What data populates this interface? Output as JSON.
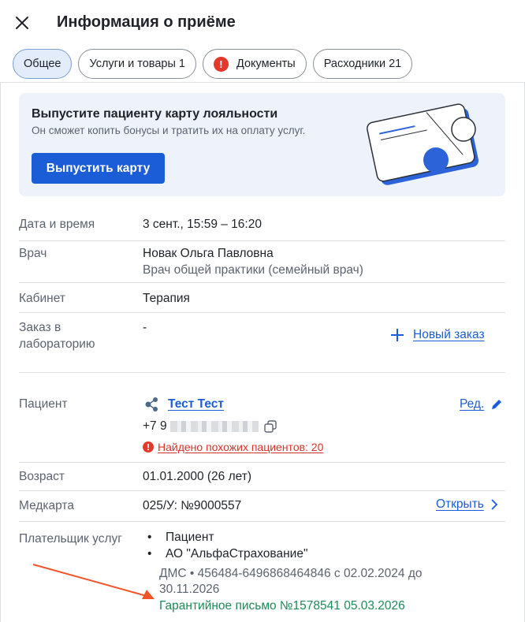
{
  "header": {
    "title": "Информация о приёме"
  },
  "tabs": [
    {
      "label": "Общее",
      "active": true
    },
    {
      "label": "Услуги и товары 1"
    },
    {
      "label": "Документы",
      "warning": "!"
    },
    {
      "label": "Расходники 21"
    }
  ],
  "banner": {
    "title": "Выпустите пациенту карту лояльности",
    "subtitle": "Он сможет копить бонусы и тратить их на оплату услуг.",
    "button": "Выпустить карту"
  },
  "visit": {
    "datetime_label": "Дата и время",
    "datetime_value": "3 сент., 15:59 – 16:20",
    "doctor_label": "Врач",
    "doctor_name": "Новак Ольга Павловна",
    "doctor_role": "Врач общей практики (семейный врач)",
    "room_label": "Кабинет",
    "room_value": "Терапия",
    "lab_label_line1": "Заказ в",
    "lab_label_line2": "лабораторию",
    "lab_value": "-",
    "new_order": "Новый заказ"
  },
  "patient": {
    "label": "Пациент",
    "name": "Тест Тест",
    "edit": "Ред.",
    "phone_prefix": "+7 9",
    "similar_warning": "Найдено похожих пациентов: 20",
    "age_label": "Возраст",
    "age_value": "01.01.2000 (26 лет)",
    "card_label": "Медкарта",
    "card_value": "025/У: №9000557",
    "open_link": "Открыть",
    "payer_label": "Плательщик услуг",
    "payer_1": "Пациент",
    "payer_2": "АО \"АльфаСтрахование\"",
    "dms_line1": "ДМС • 456484-6496868464846 с 02.02.2024 до",
    "dms_line2": "30.11.2026",
    "guarantee": "Гарантийное письмо №1578541 05.03.2026"
  },
  "colors": {
    "accent": "#1b5dd6",
    "warning": "#e5382d",
    "success": "#1e8a57",
    "annotation_arrow": "#f0552a"
  }
}
